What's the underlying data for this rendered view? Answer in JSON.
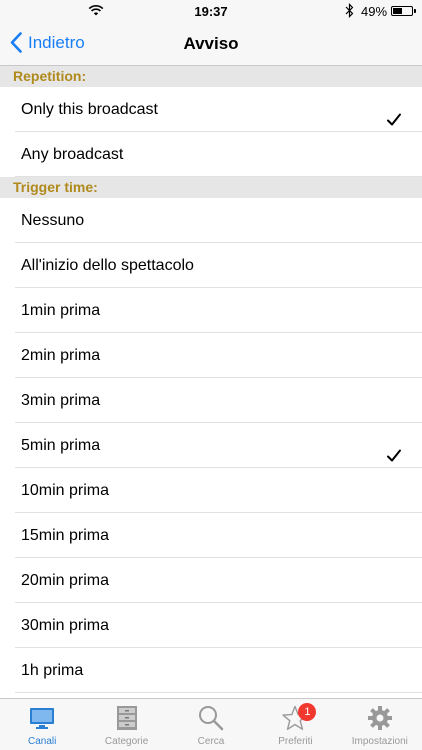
{
  "status": {
    "time": "19:37",
    "battery": "49%",
    "battery_level": 0.49
  },
  "nav": {
    "back_label": "Indietro",
    "title": "Avviso"
  },
  "sections": [
    {
      "header": "Repetition:",
      "items": [
        {
          "label": "Only this broadcast",
          "checked": true
        },
        {
          "label": "Any broadcast",
          "checked": false
        }
      ]
    },
    {
      "header": "Trigger time:",
      "items": [
        {
          "label": "Nessuno",
          "checked": false
        },
        {
          "label": "All'inizio dello spettacolo",
          "checked": false
        },
        {
          "label": "1min prima",
          "checked": false
        },
        {
          "label": "2min prima",
          "checked": false
        },
        {
          "label": "3min prima",
          "checked": false
        },
        {
          "label": "5min prima",
          "checked": true
        },
        {
          "label": "10min prima",
          "checked": false
        },
        {
          "label": "15min prima",
          "checked": false
        },
        {
          "label": "20min prima",
          "checked": false
        },
        {
          "label": "30min prima",
          "checked": false
        },
        {
          "label": "1h prima",
          "checked": false
        }
      ]
    }
  ],
  "tabs": [
    {
      "label": "Canali",
      "icon": "monitor-icon",
      "active": true
    },
    {
      "label": "Categorie",
      "icon": "cabinet-icon",
      "active": false
    },
    {
      "label": "Cerca",
      "icon": "search-icon",
      "active": false
    },
    {
      "label": "Preferiti",
      "icon": "star-icon",
      "active": false,
      "badge": "1"
    },
    {
      "label": "Impostazioni",
      "icon": "gear-icon",
      "active": false
    }
  ],
  "colors": {
    "accent": "#1a7ef5",
    "section_text": "#b08a1c",
    "badge": "#f2382e"
  }
}
